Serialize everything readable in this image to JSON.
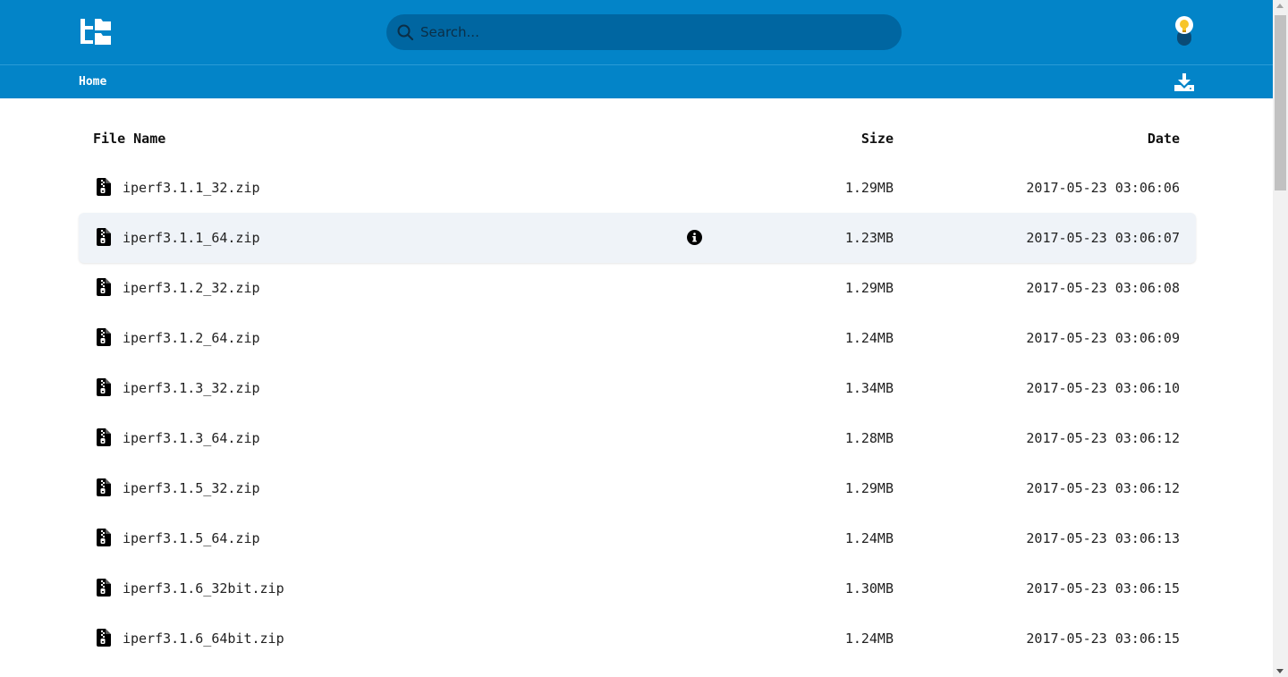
{
  "colors": {
    "header": "#0384c8",
    "search_bg": "#0066a1",
    "hover_row": "#eff3f8",
    "bulb": "#f7c52b"
  },
  "header": {
    "logo_icon": "folder-tree-icon",
    "search": {
      "placeholder": "Search..."
    },
    "theme_toggle_icon": "lightbulb-icon"
  },
  "breadcrumb": {
    "home": "Home",
    "download_icon": "download-icon"
  },
  "table": {
    "headers": {
      "name": "File Name",
      "size": "Size",
      "date": "Date"
    },
    "rows": [
      {
        "name": "iperf3.1.1_32.zip",
        "size": "1.29MB",
        "date": "2017-05-23 03:06:06"
      },
      {
        "name": "iperf3.1.1_64.zip",
        "size": "1.23MB",
        "date": "2017-05-23 03:06:07",
        "hover": true
      },
      {
        "name": "iperf3.1.2_32.zip",
        "size": "1.29MB",
        "date": "2017-05-23 03:06:08"
      },
      {
        "name": "iperf3.1.2_64.zip",
        "size": "1.24MB",
        "date": "2017-05-23 03:06:09"
      },
      {
        "name": "iperf3.1.3_32.zip",
        "size": "1.34MB",
        "date": "2017-05-23 03:06:10"
      },
      {
        "name": "iperf3.1.3_64.zip",
        "size": "1.28MB",
        "date": "2017-05-23 03:06:12"
      },
      {
        "name": "iperf3.1.5_32.zip",
        "size": "1.29MB",
        "date": "2017-05-23 03:06:12"
      },
      {
        "name": "iperf3.1.5_64.zip",
        "size": "1.24MB",
        "date": "2017-05-23 03:06:13"
      },
      {
        "name": "iperf3.1.6_32bit.zip",
        "size": "1.30MB",
        "date": "2017-05-23 03:06:15"
      },
      {
        "name": "iperf3.1.6_64bit.zip",
        "size": "1.24MB",
        "date": "2017-05-23 03:06:15"
      }
    ]
  }
}
